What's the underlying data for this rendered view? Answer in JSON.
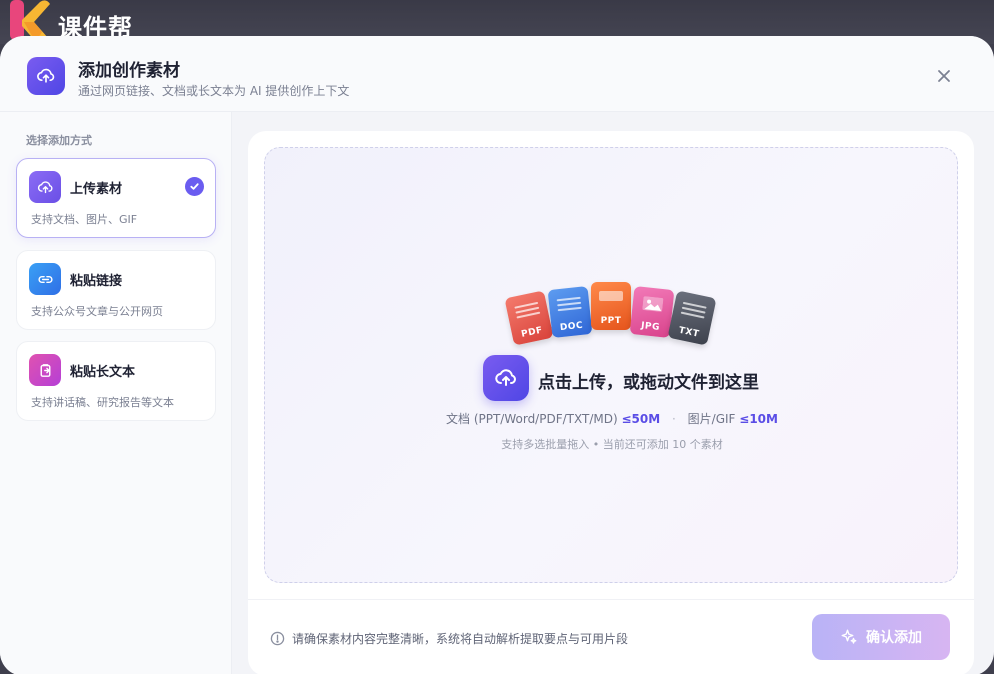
{
  "app": {
    "brand": "课件帮",
    "logo_icon": "k-logo-icon"
  },
  "modal": {
    "title": "添加创作素材",
    "subtitle": "通过网页链接、文档或长文本为 AI 提供创作上下文",
    "header_icon": "cloud-upload-icon",
    "close_icon": "close-icon"
  },
  "sidebar": {
    "heading": "选择添加方式",
    "items": [
      {
        "title": "上传素材",
        "desc": "支持文档、图片、GIF",
        "icon": "cloud-upload-icon",
        "selected": true,
        "color": "#7a5cf0"
      },
      {
        "title": "粘贴链接",
        "desc": "支持公众号文章与公开网页",
        "icon": "link-icon",
        "selected": false,
        "color": "#3b82f6"
      },
      {
        "title": "粘贴长文本",
        "desc": "支持讲话稿、研究报告等文本",
        "icon": "clipboard-text-icon",
        "selected": false,
        "color": "#d946a8"
      }
    ]
  },
  "dropzone": {
    "file_types": [
      {
        "label": "PDF",
        "color": "#ef5b52"
      },
      {
        "label": "DOC",
        "color": "#3f7fe0"
      },
      {
        "label": "PPT",
        "color": "#f26a2a"
      },
      {
        "label": "JPG",
        "color": "#e8559a"
      },
      {
        "label": "TXT",
        "color": "#4a4f5c"
      }
    ],
    "title": "点击上传，或拖动文件到这里",
    "doc_label": "文档 (PPT/Word/PDF/TXT/MD)",
    "doc_limit": "≤50M",
    "separator": "·",
    "img_label": "图片/GIF",
    "img_limit": "≤10M",
    "hint": "支持多选批量拖入 • 当前还可添加 10 个素材"
  },
  "footer": {
    "note": "请确保素材内容完整清晰，系统将自动解析提取要点与可用片段",
    "note_icon": "info-circle-icon",
    "confirm_label": "确认添加",
    "confirm_icon": "sparkle-icon"
  },
  "colors": {
    "accent": "#6a5cf0",
    "confirm_gradient_start": "#b9b3f6",
    "confirm_gradient_end": "#d7b5f2"
  }
}
